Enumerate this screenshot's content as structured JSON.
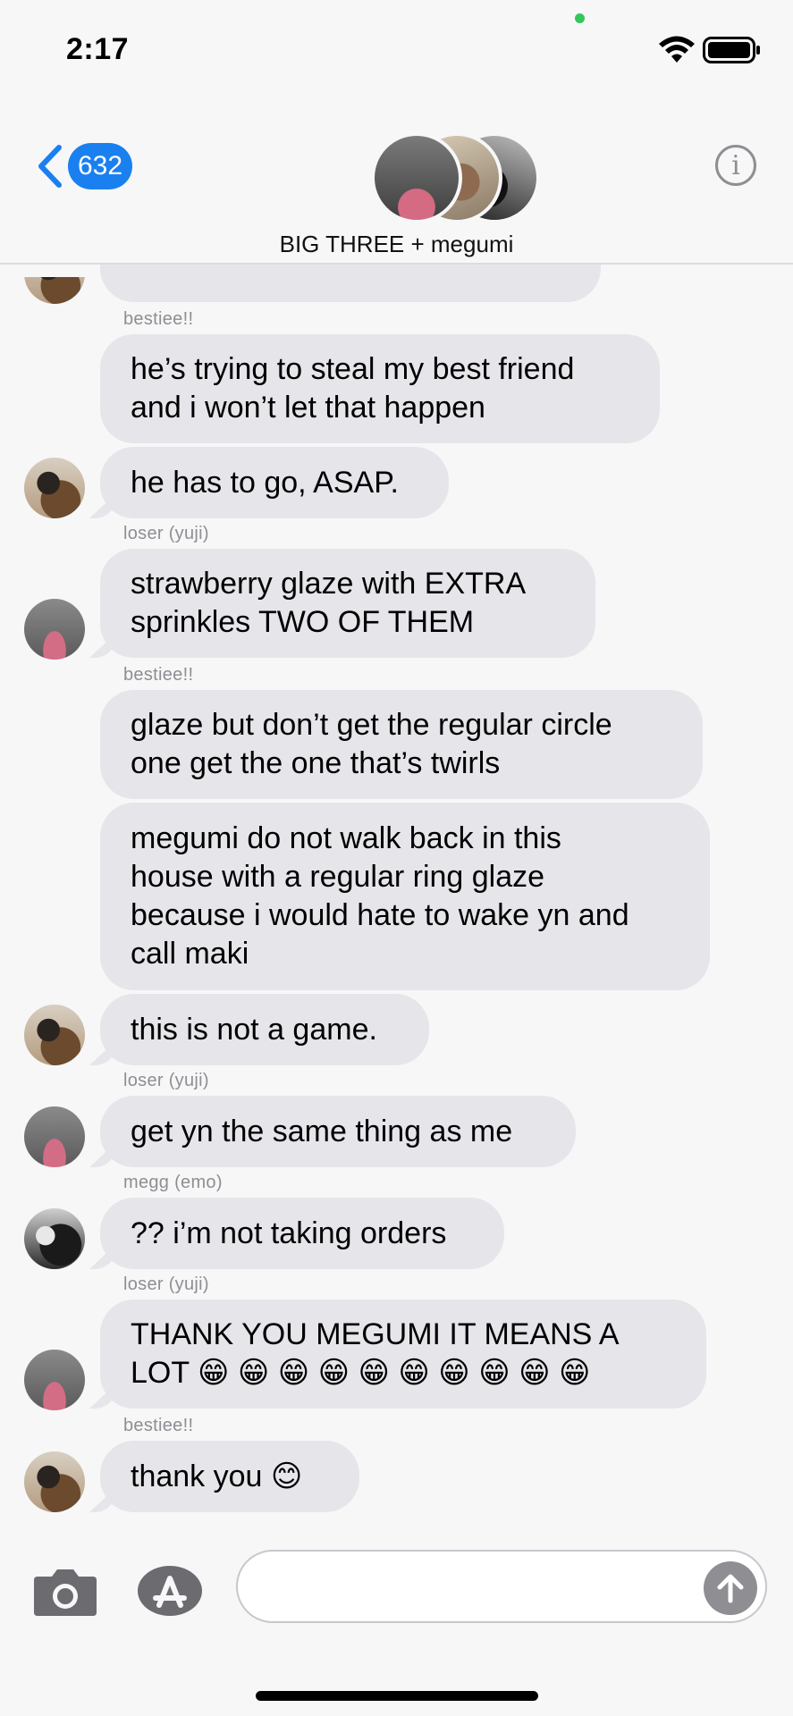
{
  "status_bar": {
    "time": "2:17"
  },
  "header": {
    "back_badge": "632",
    "title": "BIG THREE + megumi",
    "info_label": "i"
  },
  "messages": [
    {
      "text": "he’s trying to steal my best friend\nand i won’t let that happen"
    },
    {
      "text": "he has to go, ASAP."
    },
    {
      "text": "strawberry glaze with EXTRA\nsprinkles TWO OF THEM"
    },
    {
      "text": "glaze but don’t get the regular circle\none get the one that’s twirls"
    },
    {
      "text": "megumi do not walk back in this\nhouse with a regular ring glaze\nbecause i would hate to wake yn and\ncall maki"
    },
    {
      "text": "this is not a game."
    },
    {
      "text": "get yn the same thing as me"
    },
    {
      "text": "?? i’m not taking orders"
    },
    {
      "text": "THANK YOU MEGUMI IT MEANS A\nLOT 😁 😁 😁 😁 😁 😁 😁 😁 😁 😁"
    },
    {
      "text": "thank you 😊"
    }
  ],
  "senders": [
    "bestiee!!",
    "loser (yuji)",
    "bestiee!!",
    "loser (yuji)",
    "megg (emo)",
    "loser (yuji)",
    "bestiee!!"
  ],
  "input": {
    "placeholder": ""
  },
  "icons": {
    "back": "chevron-left-icon",
    "info": "info-icon",
    "camera": "camera-icon",
    "apps": "app-store-icon",
    "send": "arrow-up-icon"
  },
  "colors": {
    "accent": "#1a80f0",
    "bubble": "#e6e5ea",
    "sender_text": "#8e8e93",
    "presence": "#34c759"
  }
}
